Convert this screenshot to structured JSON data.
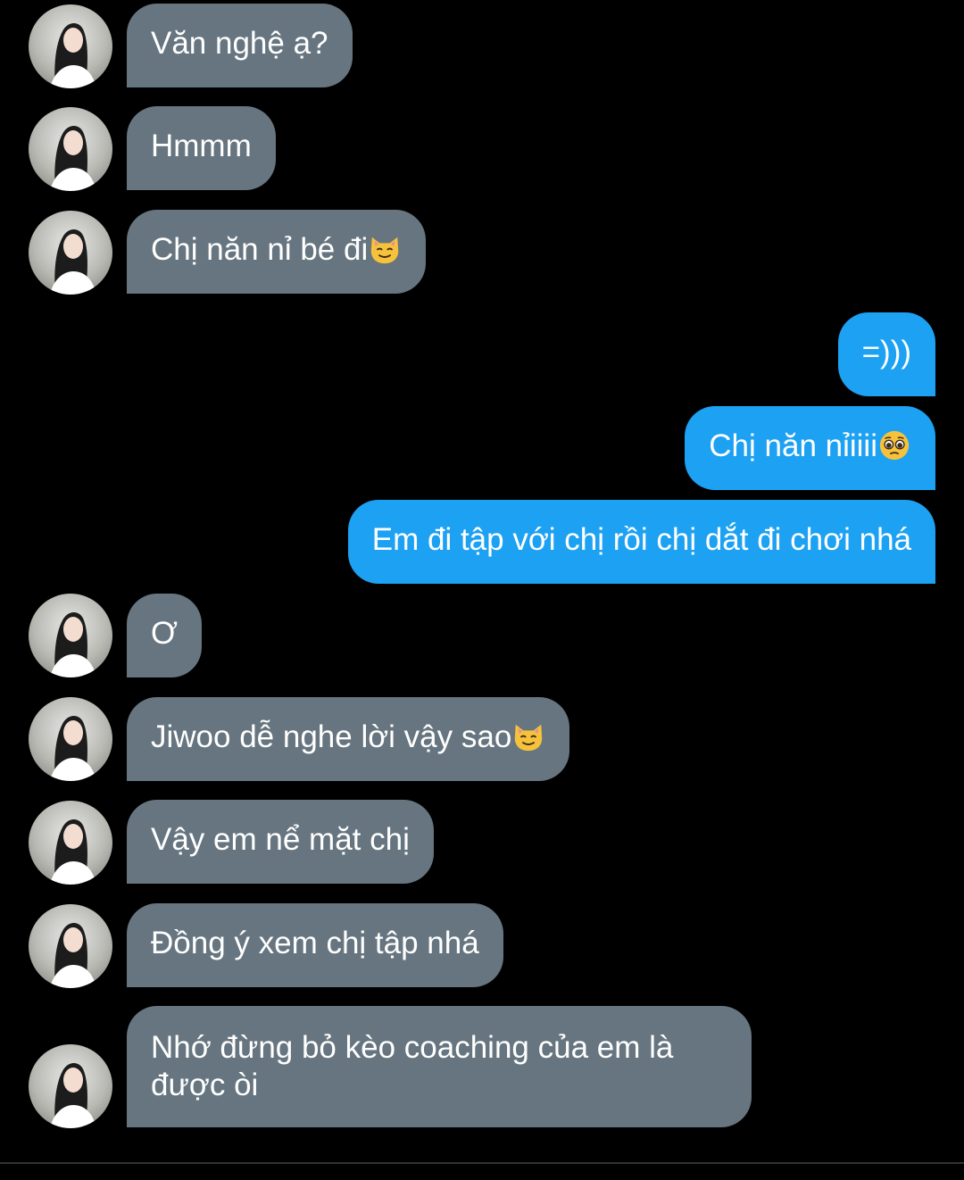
{
  "messages": [
    {
      "side": "in",
      "text": "Văn nghệ ạ?",
      "emoji": ""
    },
    {
      "side": "in",
      "text": "Hmmm",
      "emoji": ""
    },
    {
      "side": "in",
      "text": "Chị năn nỉ bé đi",
      "emoji": "smiling-cat-emoji"
    },
    {
      "side": "out",
      "text": "=)))",
      "emoji": ""
    },
    {
      "side": "out",
      "text": "Chị năn nỉiiii",
      "emoji": "pleading-face-emoji"
    },
    {
      "side": "out",
      "text": "Em đi tập với chị rồi chị dắt đi chơi nhá",
      "emoji": ""
    },
    {
      "side": "in",
      "text": "Ơ",
      "emoji": ""
    },
    {
      "side": "in",
      "text": "Jiwoo dễ nghe lời vậy sao",
      "emoji": "smiling-cat-emoji"
    },
    {
      "side": "in",
      "text": "Vậy em nể mặt chị",
      "emoji": ""
    },
    {
      "side": "in",
      "text": "Đồng ý xem chị tập nhá",
      "emoji": ""
    },
    {
      "side": "in",
      "text": "Nhớ đừng bỏ kèo coaching của em là được òi",
      "emoji": ""
    }
  ],
  "colors": {
    "background": "#000000",
    "incoming_bubble": "#66757f",
    "outgoing_bubble": "#1da1f2",
    "text": "#ffffff"
  }
}
